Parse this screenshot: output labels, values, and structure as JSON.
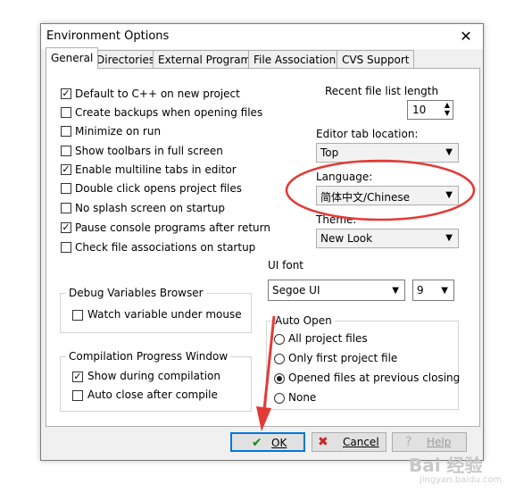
{
  "dialog": {
    "title": "Environment Options",
    "close_glyph": "✕"
  },
  "tabs": [
    {
      "label": "General",
      "active": true
    },
    {
      "label": "Directories"
    },
    {
      "label": "External Programs"
    },
    {
      "label": "File Associations"
    },
    {
      "label": "CVS Support"
    }
  ],
  "checkboxes": [
    {
      "label": "Default to C++ on new project",
      "checked": true
    },
    {
      "label": "Create backups when opening files",
      "checked": false
    },
    {
      "label": "Minimize on run",
      "checked": false
    },
    {
      "label": "Show toolbars in full screen",
      "checked": false
    },
    {
      "label": "Enable multiline tabs in editor",
      "checked": true
    },
    {
      "label": "Double click opens project files",
      "checked": false
    },
    {
      "label": "No splash screen on startup",
      "checked": false
    },
    {
      "label": "Pause console programs after return",
      "checked": true
    },
    {
      "label": "Check file associations on startup",
      "checked": false
    }
  ],
  "recent_files": {
    "label": "Recent file list length",
    "value": "10"
  },
  "editor_tab": {
    "label": "Editor tab location:",
    "value": "Top"
  },
  "language": {
    "label": "Language:",
    "value": "简体中文/Chinese"
  },
  "theme": {
    "label": "Theme:",
    "value": "New Look"
  },
  "ui_font": {
    "label": "UI font",
    "font_value": "Segoe UI",
    "size_value": "9"
  },
  "debug_group": {
    "title": "Debug Variables Browser",
    "option": "Watch variable under mouse",
    "checked": false
  },
  "compile_group": {
    "title": "Compilation Progress Window",
    "options": [
      {
        "label": "Show during compilation",
        "checked": true
      },
      {
        "label": "Auto close after compile",
        "checked": false
      }
    ]
  },
  "auto_open": {
    "title": "Auto Open",
    "options": [
      {
        "label": "All project files",
        "selected": false
      },
      {
        "label": "Only first project file",
        "selected": false
      },
      {
        "label": "Opened files at previous closing",
        "selected": true
      },
      {
        "label": "None",
        "selected": false
      }
    ]
  },
  "buttons": {
    "ok": "OK",
    "cancel": "Cancel",
    "help": "Help"
  },
  "watermark": {
    "text": "Bai 经验",
    "sub": "jingyan.baidu.com"
  },
  "colors": {
    "annotation_red": "#e53935",
    "default_button_border": "#0078d7"
  }
}
